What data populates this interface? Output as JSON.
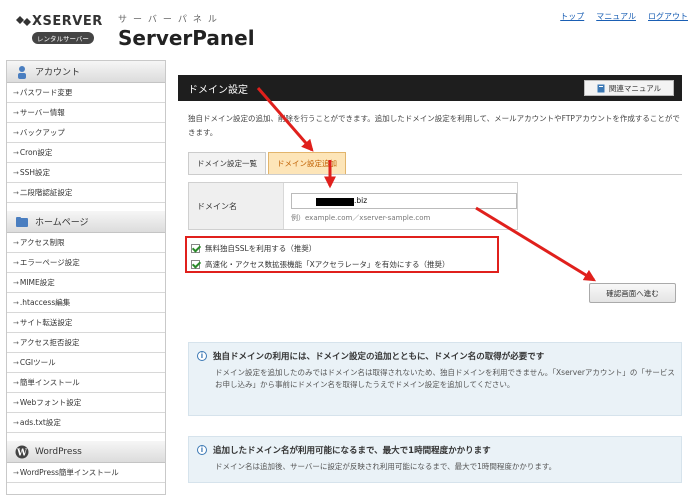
{
  "header": {
    "logo_name": "XSERVER",
    "logo_sub": "レンタルサーバー",
    "panel_kana": "サーバーパネル",
    "panel_name": "ServerPanel",
    "links": [
      "トップ",
      "マニュアル",
      "ログアウト"
    ]
  },
  "sidebar": {
    "sections": [
      {
        "title": "アカウント",
        "icon": "person-icon",
        "items": [
          "パスワード変更",
          "サーバー情報",
          "バックアップ",
          "Cron設定",
          "SSH設定",
          "二段階認証設定"
        ]
      },
      {
        "title": "ホームページ",
        "icon": "folder-icon",
        "items": [
          "アクセス制限",
          "エラーページ設定",
          "MIME設定",
          ".htaccess編集",
          "サイト転送設定",
          "アクセス拒否設定",
          "CGIツール",
          "簡単インストール",
          "Webフォント設定",
          "ads.txt設定"
        ]
      },
      {
        "title": "WordPress",
        "icon": "wordpress-icon",
        "items": [
          "WordPress簡単インストール"
        ]
      }
    ]
  },
  "main": {
    "title": "ドメイン設定",
    "manual_button": "関連マニュアル",
    "intro": "独自ドメイン設定の追加、削除を行うことができます。追加したドメイン設定を利用して、メールアカウントやFTPアカウントを作成することができます。",
    "tabs": [
      "ドメイン設定一覧",
      "ドメイン設定追加"
    ],
    "domain_label": "ドメイン名",
    "domain_value": ".biz",
    "domain_hint": "例）example.com／xserver-sample.com",
    "options": [
      "無料独自SSLを利用する（推奨）",
      "高速化・アクセス数拡張機能「Xアクセラレータ」を有効にする（推奨）"
    ],
    "confirm_button": "確認画面へ進む",
    "info1": {
      "heading": "独自ドメインの利用には、ドメイン設定の追加とともに、ドメイン名の取得が必要です",
      "body": "ドメイン設定を追加したのみではドメイン名は取得されないため、独自ドメインを利用できません。「Xserverアカウント」の「サービスお申し込み」から事前にドメイン名を取得したうえでドメイン設定を追加してください。"
    },
    "info2": {
      "heading": "追加したドメイン名が利用可能になるまで、最大で1時間程度かかります",
      "body": "ドメイン名は追加後、サーバーに設定が反映され利用可能になるまで、最大で1時間程度かかります。"
    }
  },
  "colors": {
    "highlight": "#e0201c",
    "active_tab": "#fde5b8",
    "link": "#1a5fb4",
    "title_bar": "#1e1e1e"
  }
}
